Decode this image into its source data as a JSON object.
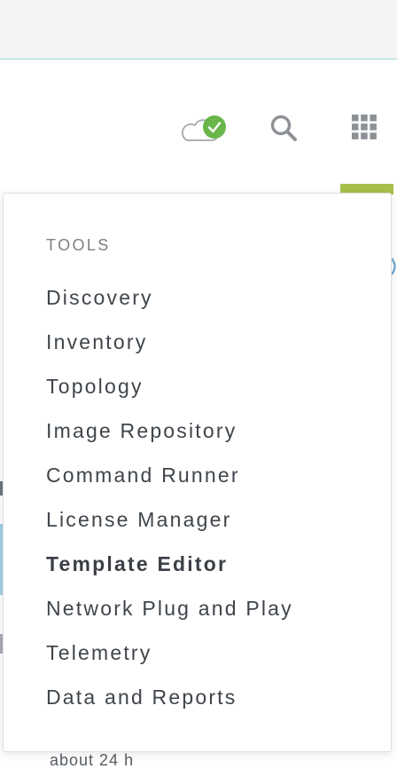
{
  "header": {
    "icons": {
      "cloud_status": "cloud-check-icon",
      "search": "search-icon",
      "apps": "grid-menu-icon"
    },
    "colors": {
      "status_green": "#6ab64a",
      "active_indicator": "#a7c04a",
      "icon_gray": "#8d9196"
    }
  },
  "background": {
    "bottom_text": "about 24 h"
  },
  "tools_menu": {
    "heading": "TOOLS",
    "items": [
      {
        "label": "Discovery"
      },
      {
        "label": "Inventory"
      },
      {
        "label": "Topology"
      },
      {
        "label": "Image Repository"
      },
      {
        "label": "Command Runner"
      },
      {
        "label": "License Manager"
      },
      {
        "label": "Template Editor",
        "active": true
      },
      {
        "label": "Network Plug and Play"
      },
      {
        "label": "Telemetry"
      },
      {
        "label": "Data and Reports"
      }
    ]
  }
}
